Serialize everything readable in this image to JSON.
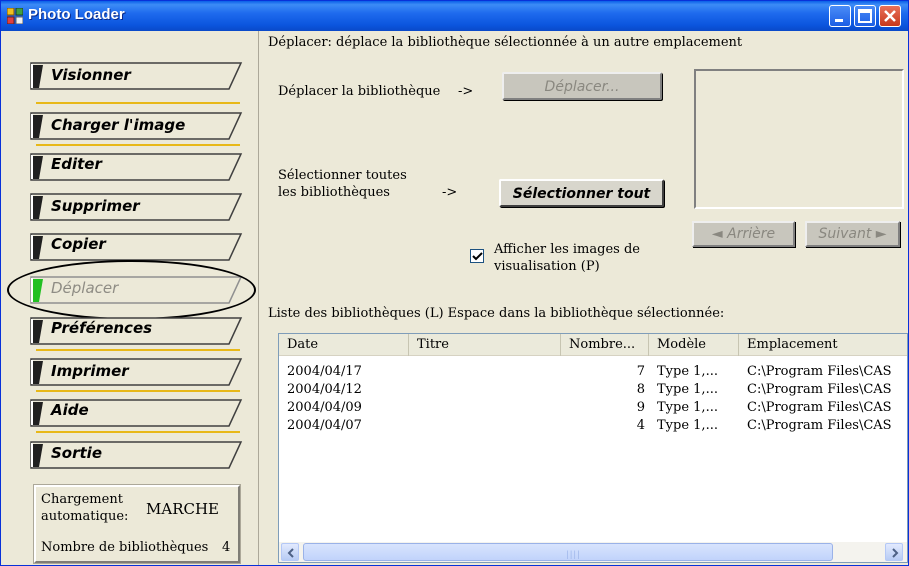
{
  "window": {
    "title": "Photo Loader"
  },
  "sidebar": {
    "items": [
      {
        "label": "Visionner"
      },
      {
        "label": "Charger l'image"
      },
      {
        "label": "Editer"
      },
      {
        "label": "Supprimer"
      },
      {
        "label": "Copier"
      },
      {
        "label": "Déplacer"
      },
      {
        "label": "Préférences"
      },
      {
        "label": "Imprimer"
      },
      {
        "label": "Aide"
      },
      {
        "label": "Sortie"
      }
    ],
    "status": {
      "auto_label": "Chargement automatique:",
      "auto_value": "MARCHE",
      "count_label": "Nombre de bibliothèques",
      "count_value": "4"
    }
  },
  "main": {
    "description": "Déplacer: déplace la bibliothèque sélectionnée à un autre emplacement",
    "move_label": "Déplacer la bibliothèque",
    "arrow": "->",
    "move_button": "Déplacer...",
    "select_all_label": "Sélectionner toutes les bibliothèques",
    "select_all_button": "Sélectionner tout",
    "prev_button": "◄ Arrière",
    "next_button": "Suivant ►",
    "show_previews_label": "Afficher les images de visualisation (P)",
    "show_previews_checked": true,
    "list_caption": "Liste des bibliothèques (L)  Espace dans la bibliothèque sélectionnée:",
    "columns": [
      "Date",
      "Titre",
      "Nombre...",
      "Modèle",
      "Emplacement"
    ],
    "rows": [
      {
        "date": "2004/04/17",
        "title": "",
        "count": "7",
        "model": "Type 1,...",
        "location": "C:\\Program Files\\CAS"
      },
      {
        "date": "2004/04/12",
        "title": "",
        "count": "8",
        "model": "Type 1,...",
        "location": "C:\\Program Files\\CAS"
      },
      {
        "date": "2004/04/09",
        "title": "",
        "count": "9",
        "model": "Type 1,...",
        "location": "C:\\Program Files\\CAS"
      },
      {
        "date": "2004/04/07",
        "title": "",
        "count": "4",
        "model": "Type 1,...",
        "location": "C:\\Program Files\\CAS"
      }
    ]
  },
  "colors": {
    "titlebar": "#0b55de",
    "separator": "#e8b818",
    "active_tab_marker": "#22c022"
  }
}
